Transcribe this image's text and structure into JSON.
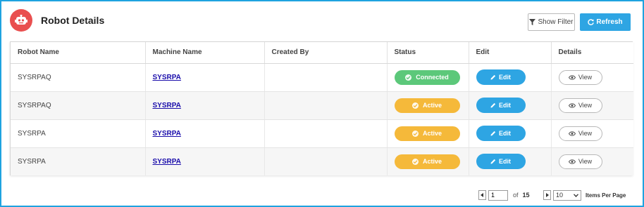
{
  "header": {
    "title": "Robot Details",
    "avatar_icon": "robot-icon"
  },
  "toolbar": {
    "filter_label": "Show Filter",
    "refresh_label": "Refresh"
  },
  "table": {
    "columns": [
      "Robot Name",
      "Machine Name",
      "Created By",
      "Status",
      "Edit",
      "Details"
    ],
    "rows": [
      {
        "robot_name": "SYSRPAQ",
        "machine_name": "SYSRPA",
        "created_by": "",
        "status": "Connected",
        "status_color": "#5cc87a",
        "edit_label": "Edit",
        "view_label": "View"
      },
      {
        "robot_name": "SYSRPAQ",
        "machine_name": "SYSRPA",
        "created_by": "",
        "status": "Active",
        "status_color": "#f5b93a",
        "edit_label": "Edit",
        "view_label": "View"
      },
      {
        "robot_name": "SYSRPA",
        "machine_name": "SYSRPA",
        "created_by": "",
        "status": "Active",
        "status_color": "#f5b93a",
        "edit_label": "Edit",
        "view_label": "View"
      },
      {
        "robot_name": "SYSRPA",
        "machine_name": "SYSRPA",
        "created_by": "",
        "status": "Active",
        "status_color": "#f5b93a",
        "edit_label": "Edit",
        "view_label": "View"
      }
    ]
  },
  "pagination": {
    "current_page": "1",
    "of_label": "of",
    "total_pages": "15",
    "items_per_page": "10",
    "items_per_page_label": "Items Per Page"
  },
  "colors": {
    "accent": "#2ea5e3",
    "frame": "#1fa3e0",
    "avatar": "#e94f4f"
  }
}
